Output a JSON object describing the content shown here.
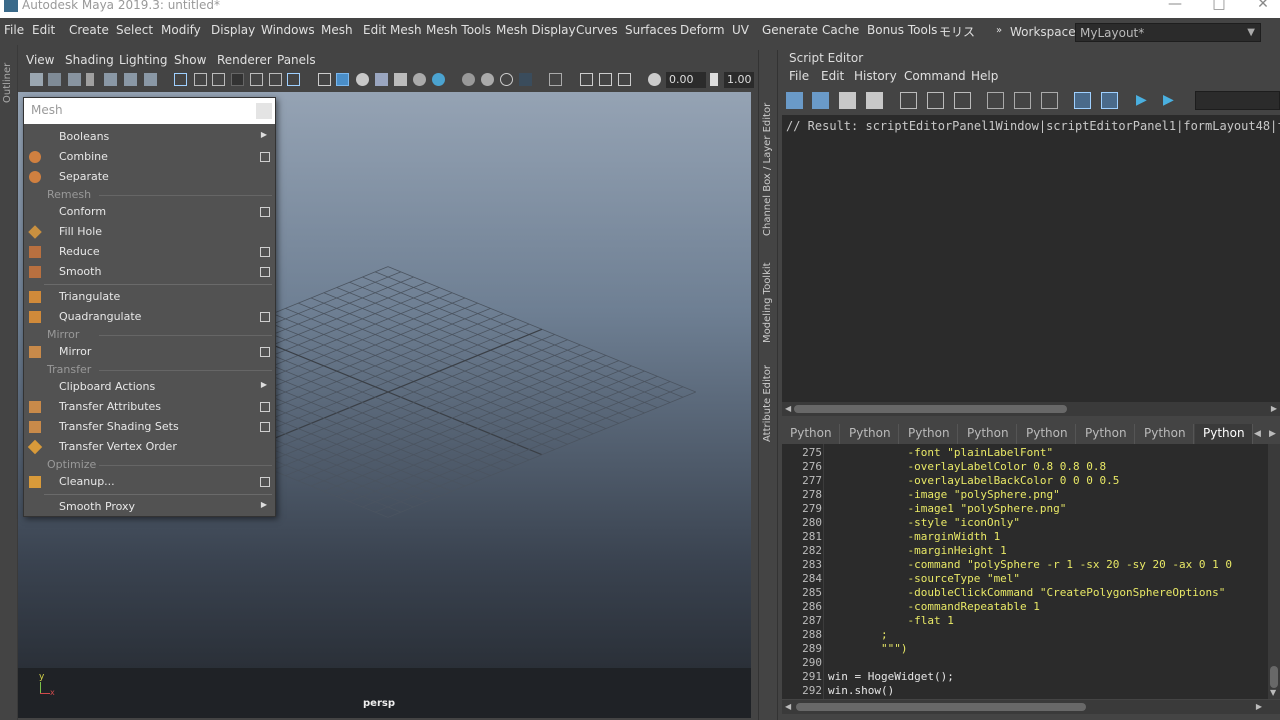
{
  "window": {
    "title": "Autodesk Maya 2019.3: untitled*"
  },
  "main_menu": [
    "File",
    "Edit",
    "Create",
    "Select",
    "Modify",
    "Display",
    "Windows",
    "Mesh",
    "Edit Mesh",
    "Mesh Tools",
    "Mesh Display",
    "Curves",
    "Surfaces",
    "Deform",
    "UV",
    "Generate",
    "Cache",
    "Bonus Tools",
    "モリス"
  ],
  "workspace": {
    "label": "Workspace :",
    "value": "MyLayout*"
  },
  "outliner": {
    "label": "Outliner"
  },
  "viewport": {
    "menu": [
      "View",
      "Shading",
      "Lighting",
      "Show",
      "Renderer",
      "Panels"
    ],
    "field_a": "0.00",
    "field_b": "1.00",
    "camera": "persp"
  },
  "mesh_menu": {
    "title": "Mesh",
    "items": [
      {
        "label": "Booleans"
      },
      {
        "label": "Combine"
      },
      {
        "label": "Separate"
      },
      {
        "label": "Conform"
      },
      {
        "label": "Fill Hole"
      },
      {
        "label": "Reduce"
      },
      {
        "label": "Smooth"
      },
      {
        "label": "Triangulate"
      },
      {
        "label": "Quadrangulate"
      },
      {
        "label": "Mirror"
      },
      {
        "label": "Clipboard Actions"
      },
      {
        "label": "Transfer Attributes"
      },
      {
        "label": "Transfer Shading Sets"
      },
      {
        "label": "Transfer Vertex Order"
      },
      {
        "label": "Cleanup..."
      },
      {
        "label": "Smooth Proxy"
      }
    ],
    "sections": [
      "Remesh",
      "Mirror",
      "Transfer",
      "Optimize"
    ]
  },
  "side_tabs": [
    "Channel Box / Layer Editor",
    "Modeling Toolkit",
    "Attribute Editor"
  ],
  "script_editor": {
    "title": "Script Editor",
    "menu": [
      "File",
      "Edit",
      "History",
      "Command",
      "Help"
    ],
    "result_line": "// Result: scriptEditorPanel1Window|scriptEditorPanel1|formLayout48|f",
    "tabs": [
      "Python",
      "Python",
      "Python",
      "Python",
      "Python",
      "Python",
      "Python",
      "Python"
    ],
    "code_lines": [
      {
        "n": "275",
        "t": "            -font \"plainLabelFont\""
      },
      {
        "n": "276",
        "t": "            -overlayLabelColor 0.8 0.8 0.8"
      },
      {
        "n": "277",
        "t": "            -overlayLabelBackColor 0 0 0 0.5"
      },
      {
        "n": "278",
        "t": "            -image \"polySphere.png\""
      },
      {
        "n": "279",
        "t": "            -image1 \"polySphere.png\""
      },
      {
        "n": "280",
        "t": "            -style \"iconOnly\""
      },
      {
        "n": "281",
        "t": "            -marginWidth 1"
      },
      {
        "n": "282",
        "t": "            -marginHeight 1"
      },
      {
        "n": "283",
        "t": "            -command \"polySphere -r 1 -sx 20 -sy 20 -ax 0 1 0"
      },
      {
        "n": "284",
        "t": "            -sourceType \"mel\""
      },
      {
        "n": "285",
        "t": "            -doubleClickCommand \"CreatePolygonSphereOptions\""
      },
      {
        "n": "286",
        "t": "            -commandRepeatable 1"
      },
      {
        "n": "287",
        "t": "            -flat 1"
      },
      {
        "n": "288",
        "t": "        ;"
      },
      {
        "n": "289",
        "t": "        \"\"\")"
      },
      {
        "n": "290",
        "t": ""
      },
      {
        "n": "291",
        "t": "win = HogeWidget();"
      },
      {
        "n": "292",
        "t": "win.show()"
      }
    ]
  },
  "colors": {
    "panel": "#444444",
    "editor_bg": "#2b2b2b",
    "code_yellow": "#e8e866",
    "viewport_top": "#95a3b4",
    "viewport_bottom": "#23272d"
  }
}
